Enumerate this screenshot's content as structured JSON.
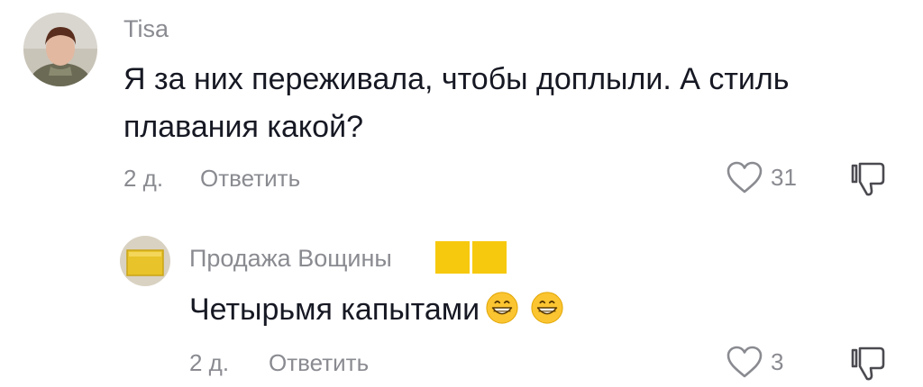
{
  "comments": [
    {
      "username": "Tisa",
      "text_line1": "Я за них переживала, чтобы доплыли. А стиль",
      "text_line2": "плавания какой?",
      "time": "2 д.",
      "reply_label": "Ответить",
      "like_count": "31",
      "avatar_icon": "user-photo-avatar"
    },
    {
      "username": "Продажа Вощины",
      "badge_colors": [
        "#f6c90e",
        "#f6c90e"
      ],
      "text": "Четырьмя капытами",
      "emojis": [
        "grinning-face",
        "grinning-face"
      ],
      "time": "2 д.",
      "reply_label": "Ответить",
      "like_count": "3",
      "avatar_icon": "wax-sheet-avatar"
    }
  ],
  "colors": {
    "text": "#161823",
    "muted": "#8a8b91",
    "badge": "#f6c90e"
  }
}
